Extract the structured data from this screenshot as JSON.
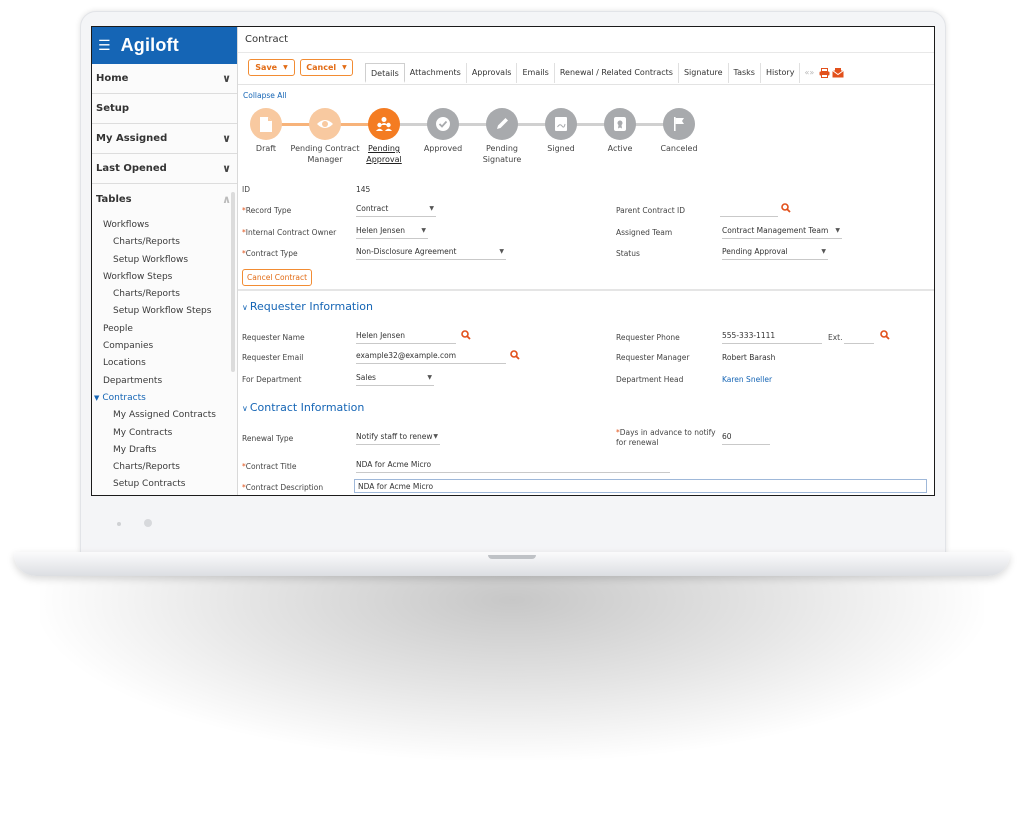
{
  "app": {
    "name": "Agiloft"
  },
  "sidebar": {
    "sections": [
      {
        "label": "Home",
        "chevron": "down"
      },
      {
        "label": "Setup",
        "chevron": ""
      },
      {
        "label": "My Assigned",
        "chevron": "down"
      },
      {
        "label": "Last Opened",
        "chevron": "down"
      },
      {
        "label": "Tables",
        "chevron": "up"
      }
    ],
    "tree": [
      {
        "label": "Workflows",
        "level": 1
      },
      {
        "label": "Charts/Reports",
        "level": 2
      },
      {
        "label": "Setup Workflows",
        "level": 2
      },
      {
        "label": "Workflow Steps",
        "level": 1
      },
      {
        "label": "Charts/Reports",
        "level": 2
      },
      {
        "label": "Setup Workflow Steps",
        "level": 2
      },
      {
        "label": "People",
        "level": 1
      },
      {
        "label": "Companies",
        "level": 1
      },
      {
        "label": "Locations",
        "level": 1
      },
      {
        "label": "Departments",
        "level": 1
      },
      {
        "label": "Contracts",
        "level": 1,
        "active": true
      },
      {
        "label": "My Assigned Contracts",
        "level": 2
      },
      {
        "label": "My Contracts",
        "level": 2
      },
      {
        "label": "My Drafts",
        "level": 2
      },
      {
        "label": "Charts/Reports",
        "level": 2
      },
      {
        "label": "Setup Contracts",
        "level": 2
      }
    ]
  },
  "header": {
    "title": "Contract"
  },
  "toolbar": {
    "save_label": "Save",
    "cancel_label": "Cancel"
  },
  "tabs": [
    "Details",
    "Attachments",
    "Approvals",
    "Emails",
    "Renewal / Related Contracts",
    "Signature",
    "Tasks",
    "History"
  ],
  "active_tab": "Details",
  "tab_more": "«»",
  "collapse_all": "Collapse All",
  "workflow": {
    "current_index": 2,
    "steps": [
      {
        "label": "Draft",
        "icon": "document-icon",
        "state": "done"
      },
      {
        "label": "Pending Contract Manager",
        "icon": "eye-icon",
        "state": "done"
      },
      {
        "label": "Pending Approval",
        "icon": "people-icon",
        "state": "current"
      },
      {
        "label": "Approved",
        "icon": "checkmark-icon",
        "state": "future"
      },
      {
        "label": "Pending Signature",
        "icon": "pen-icon",
        "state": "future"
      },
      {
        "label": "Signed",
        "icon": "signed-document-icon",
        "state": "future"
      },
      {
        "label": "Active",
        "icon": "badge-icon",
        "state": "future"
      },
      {
        "label": "Canceled",
        "icon": "flag-icon",
        "state": "future"
      }
    ]
  },
  "fields": {
    "id": {
      "label": "ID",
      "value": "145"
    },
    "record_type": {
      "label": "Record Type",
      "value": "Contract"
    },
    "parent_contract_id": {
      "label": "Parent Contract ID",
      "value": ""
    },
    "internal_owner": {
      "label": "Internal Contract Owner",
      "value": "Helen Jensen"
    },
    "assigned_team": {
      "label": "Assigned Team",
      "value": "Contract Management Team"
    },
    "contract_type": {
      "label": "Contract Type",
      "value": "Non-Disclosure Agreement"
    },
    "status": {
      "label": "Status",
      "value": "Pending Approval"
    }
  },
  "cancel_contract_label": "Cancel Contract",
  "requester": {
    "title": "Requester Information",
    "name": {
      "label": "Requester Name",
      "value": "Helen Jensen"
    },
    "phone": {
      "label": "Requester Phone",
      "value": "555-333-1111",
      "ext_label": "Ext."
    },
    "email": {
      "label": "Requester Email",
      "value": "example32@example.com"
    },
    "manager": {
      "label": "Requester Manager",
      "value": "Robert Barash"
    },
    "department": {
      "label": "For Department",
      "value": "Sales"
    },
    "department_head": {
      "label": "Department Head",
      "value": "Karen Sneller"
    }
  },
  "contract_info": {
    "title": "Contract Information",
    "renewal_type": {
      "label": "Renewal Type",
      "value": "Notify staff to renew"
    },
    "days_advance": {
      "label": "Days in advance to notify for renewal",
      "label_line1": "Days in advance to notify",
      "label_line2": "for renewal",
      "value": "60"
    },
    "contract_title": {
      "label": "Contract Title",
      "value": "NDA for Acme Micro"
    },
    "contract_description": {
      "label": "Contract Description",
      "value": "NDA for Acme Micro"
    }
  },
  "colors": {
    "brand": "#1565b5",
    "accent": "#f47c22",
    "required": "#e0541b",
    "link": "#1565b5"
  }
}
